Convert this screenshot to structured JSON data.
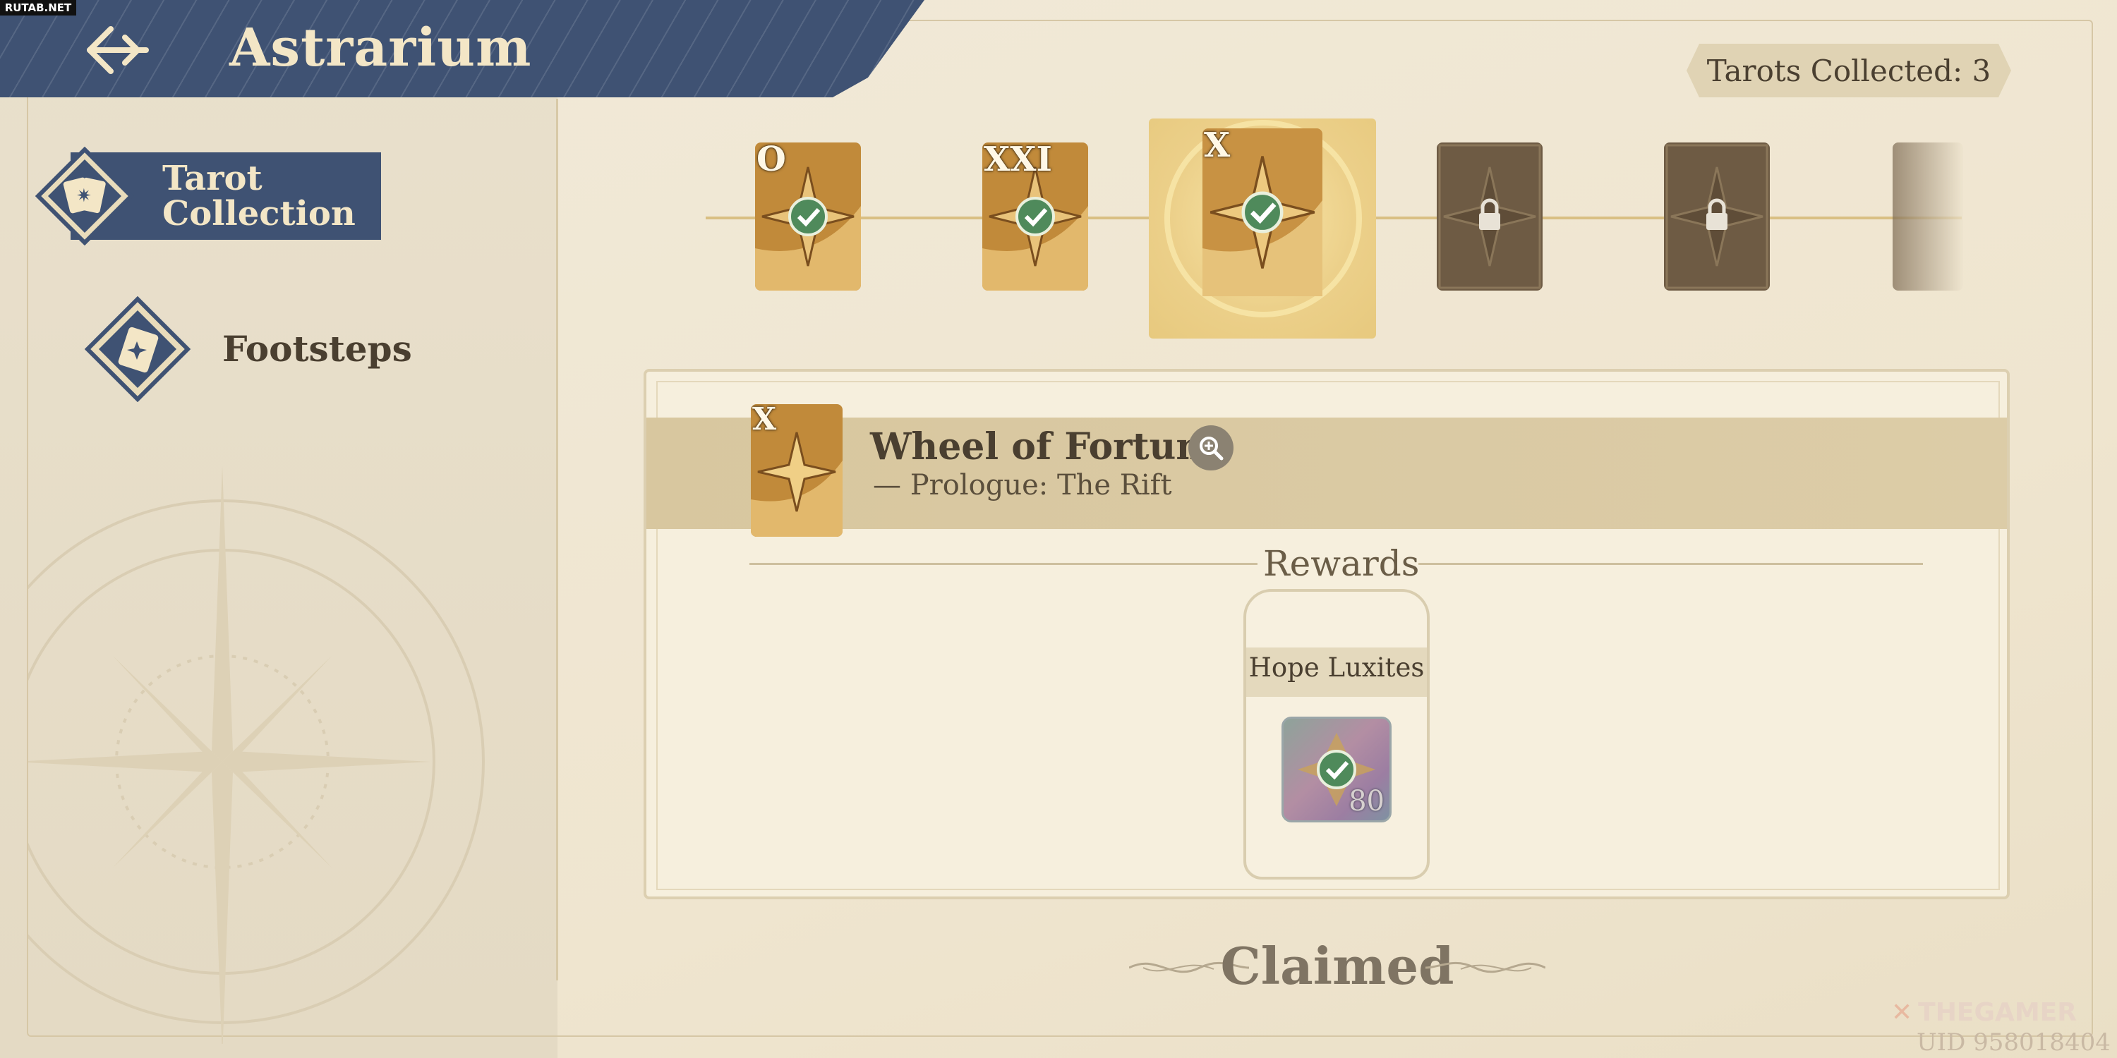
{
  "header": {
    "title": "Astrarium",
    "back_icon": "back-arrow-icon"
  },
  "watermark_top": "RUTAB.NET",
  "tarots_collected": "Tarots Collected: 3",
  "sidebar": {
    "items": [
      {
        "label": "Tarot Collection",
        "icon": "tarot-cards-icon",
        "active": true
      },
      {
        "label": "Footsteps",
        "icon": "footsteps-book-icon",
        "active": false
      }
    ]
  },
  "tarot_track": {
    "cards": [
      {
        "numeral": "O",
        "state": "claimed"
      },
      {
        "numeral": "XXI",
        "state": "claimed"
      },
      {
        "numeral": "X",
        "state": "claimed",
        "selected": true
      },
      {
        "numeral": "",
        "state": "locked"
      },
      {
        "numeral": "",
        "state": "locked"
      },
      {
        "numeral": "",
        "state": "locked"
      }
    ]
  },
  "detail": {
    "card_numeral": "X",
    "title": "Wheel of Fortune",
    "subtitle": "— Prologue: The Rift",
    "rewards_heading": "Rewards",
    "reward": {
      "name": "Hope Luxites",
      "quantity": "80",
      "claimed": true
    }
  },
  "claimed_label": "Claimed",
  "brand": "THEGAMER",
  "uid": "UID 958018404",
  "colors": {
    "header": "#3f5273",
    "gold": "#c99a3f",
    "locked": "#6e5b44",
    "check": "#4f8a5b",
    "panel": "#f6efdd"
  }
}
